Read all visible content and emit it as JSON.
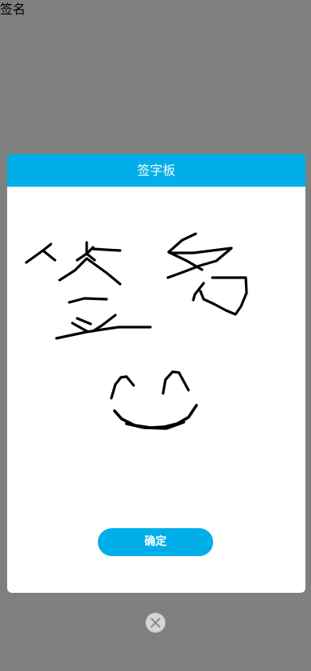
{
  "page": {
    "label": "签名"
  },
  "dialog": {
    "title": "签字板",
    "confirm_label": "确定"
  },
  "icons": {
    "close": "close-icon"
  },
  "colors": {
    "accent": "#00aeea",
    "overlay": "rgba(0,0,0,0.5)",
    "stroke": "#000000"
  }
}
